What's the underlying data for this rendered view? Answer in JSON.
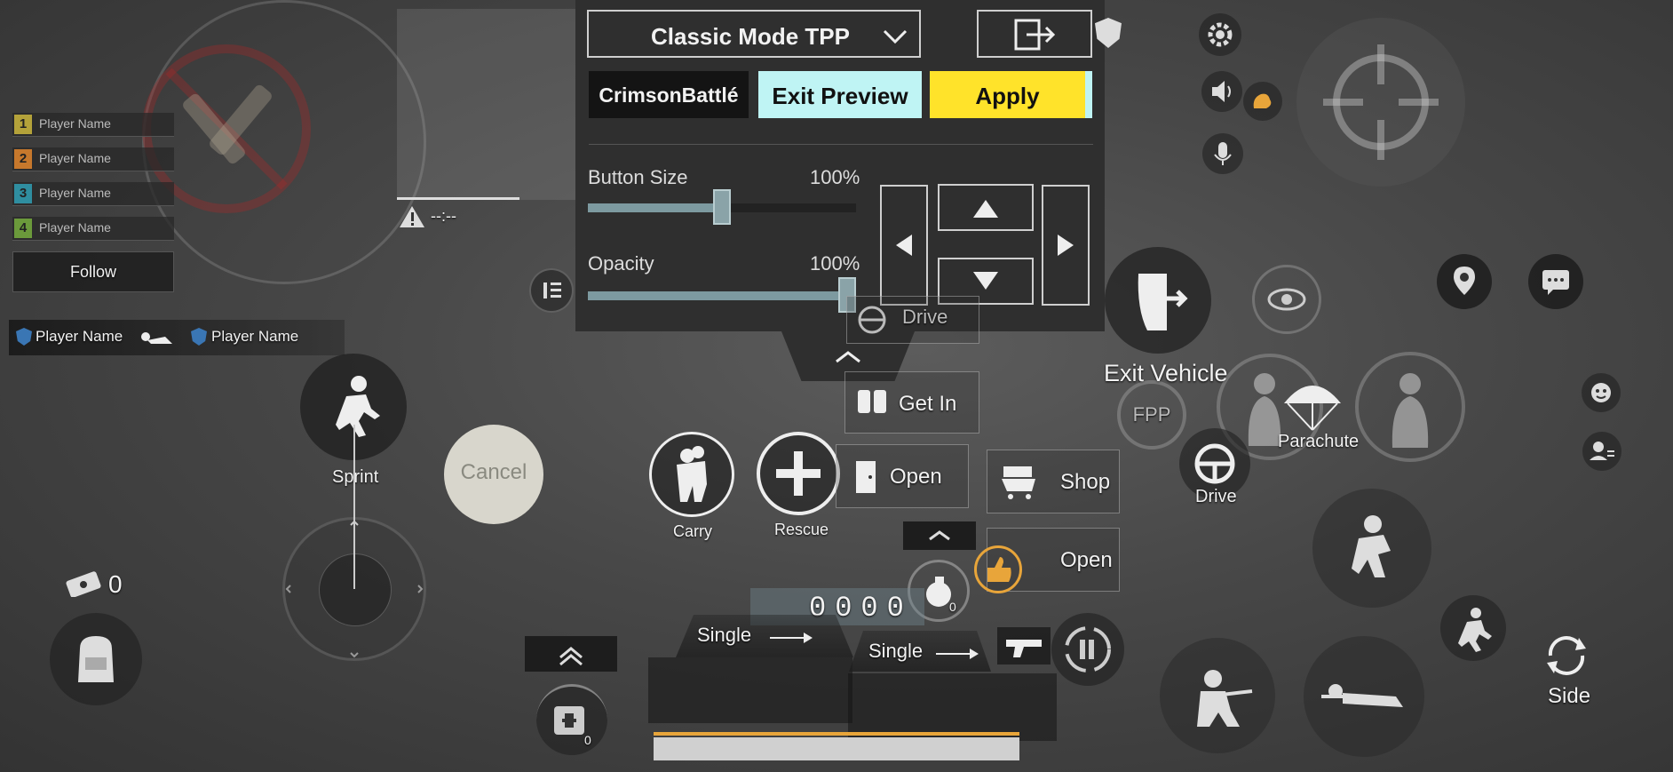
{
  "top_panel": {
    "mode_select": "Classic Mode TPP",
    "profile_name": "CrimsonBattlé",
    "exit_preview": "Exit Preview",
    "apply": "Apply",
    "button_size_label": "Button Size",
    "button_size_value": "100%",
    "button_size_fraction": 0.5,
    "opacity_label": "Opacity",
    "opacity_value": "100%",
    "opacity_fraction": 1.0
  },
  "players": [
    {
      "num": "1",
      "name": "Player Name",
      "color": "#b4a23a"
    },
    {
      "num": "2",
      "name": "Player Name",
      "color": "#c7782c"
    },
    {
      "num": "3",
      "name": "Player Name",
      "color": "#2f8ea0"
    },
    {
      "num": "4",
      "name": "Player Name",
      "color": "#6b9a3b"
    }
  ],
  "follow": "Follow",
  "knock_feed": {
    "left": "Player Name",
    "right": "Player Name"
  },
  "timer": "--:--",
  "labels": {
    "sprint": "Sprint",
    "cancel": "Cancel",
    "carry": "Carry",
    "rescue": "Rescue",
    "drive_top": "Drive",
    "get_in": "Get In",
    "open_door": "Open",
    "shop": "Shop",
    "open_pickup": "Open",
    "exit_vehicle": "Exit Vehicle",
    "fpp": "FPP",
    "parachute": "Parachute",
    "drive": "Drive",
    "side": "Side",
    "single_left": "Single",
    "single_right": "Single",
    "ammo": "0000",
    "items_count": "0",
    "grenade_count": "0",
    "heal_count": "0"
  },
  "colors": {
    "apply": "#ffe32a",
    "exit_preview": "#bff4f4",
    "accent": "#e8a53a"
  }
}
